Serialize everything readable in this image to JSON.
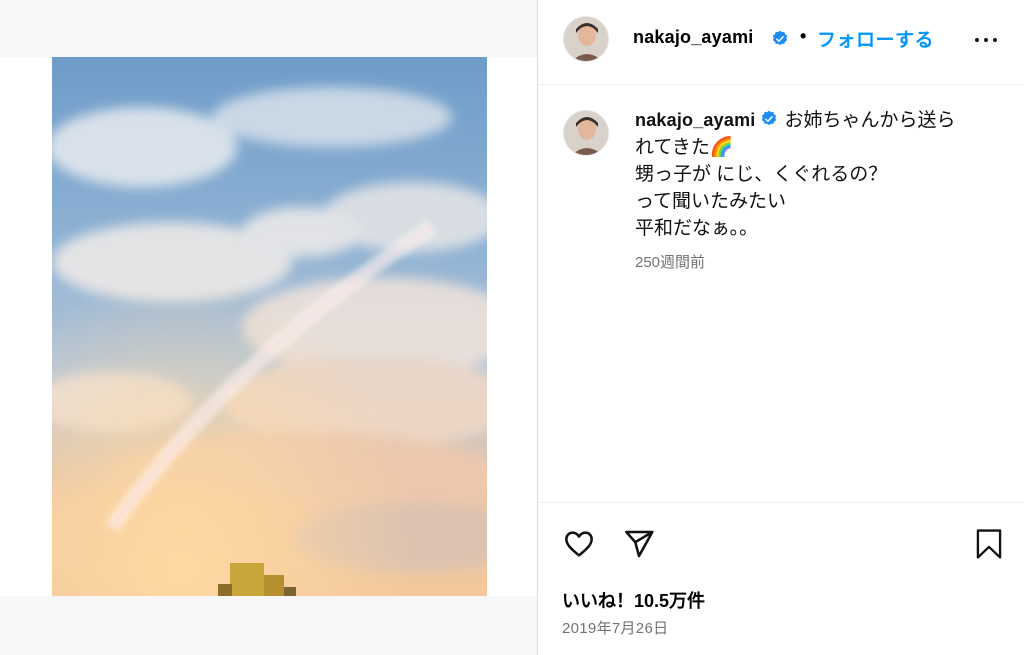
{
  "post": {
    "image": {
      "subject": "rainbow-sky-photo"
    }
  },
  "header": {
    "username": "nakajo_ayami",
    "separator": "•",
    "follow_label": "フォローする",
    "more_icon": "more-horizontal-icon"
  },
  "caption": {
    "username": "nakajo_ayami",
    "lines": [
      "お姉ちゃんから送ら",
      "れてきた🌈",
      "甥っ子が にじ、くぐれるの？",
      "って聞いたみたい",
      "平和だなぁ。。"
    ],
    "time_ago": "250週間前"
  },
  "actions": {
    "like_icon": "heart-icon",
    "share_icon": "paper-plane-icon",
    "save_icon": "bookmark-icon",
    "likes_label": "いいね！10.5万件",
    "date": "2019年7月26日"
  },
  "colors": {
    "accent": "#0095f6",
    "verified": "#1f8df5",
    "muted": "#737373",
    "divider": "#efefef"
  }
}
